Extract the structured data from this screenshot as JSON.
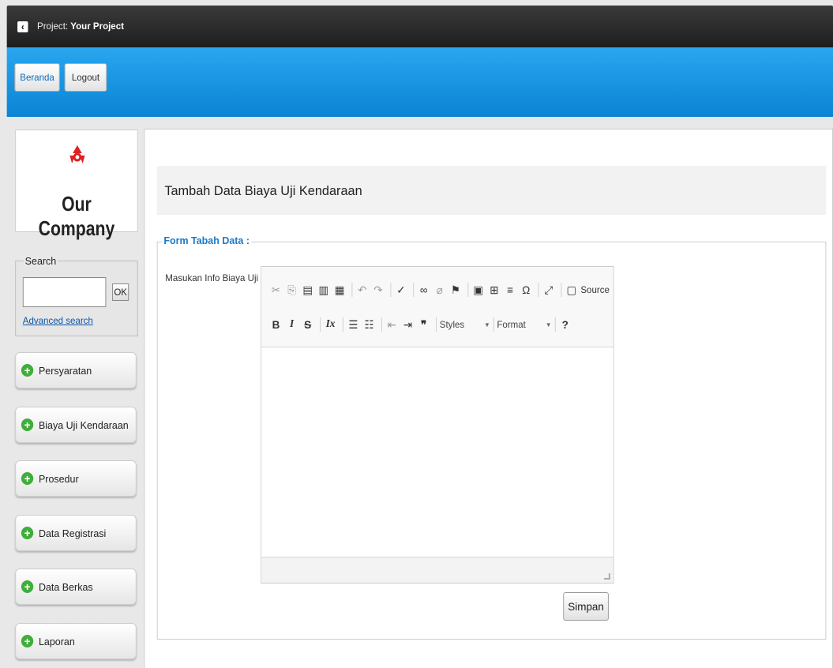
{
  "header": {
    "project_prefix": "Project:",
    "project_name": "Your Project"
  },
  "nav": {
    "home_label": "Beranda",
    "logout_label": "Logout"
  },
  "sidebar": {
    "logo_text": "Our Company",
    "search": {
      "legend": "Search",
      "value": "",
      "ok_label": "OK",
      "advanced_link": "Advanced search"
    },
    "items": [
      {
        "label": "Persyaratan"
      },
      {
        "label": "Biaya Uji Kendaraan"
      },
      {
        "label": "Prosedur"
      },
      {
        "label": "Data Registrasi"
      },
      {
        "label": "Data Berkas"
      },
      {
        "label": "Laporan"
      }
    ]
  },
  "main": {
    "title": "Tambah Data Biaya Uji Kendaraan",
    "form": {
      "legend": "Form Tabah Data :",
      "field_label": "Masukan Info Biaya Uji",
      "editor_content": "",
      "toolbar": {
        "source_label": "Source",
        "styles_label": "Styles",
        "format_label": "Format",
        "help_label": "?"
      },
      "submit_label": "Simpan"
    }
  },
  "colors": {
    "nav_blue": "#1a97e3",
    "accent_link": "#1a7ac9",
    "plus_green": "#3fae3a",
    "logo_red": "#e02020"
  }
}
